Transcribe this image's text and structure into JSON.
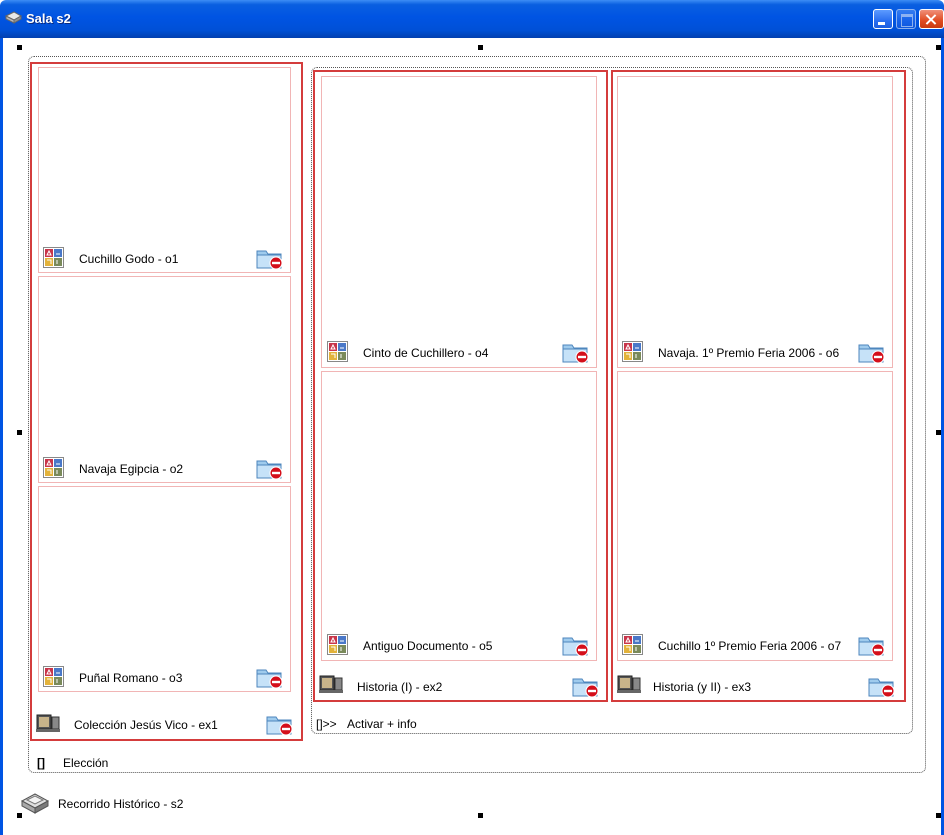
{
  "window": {
    "title": "Sala s2"
  },
  "sala": {
    "label": "Recorrido Histórico - s2"
  },
  "eleccion": {
    "label": "Elección",
    "marker": "[]"
  },
  "activar": {
    "label": "Activar + info",
    "marker": "[]>>"
  },
  "exhibits": {
    "ex1": {
      "label": "Colección Jesús Vico - ex1"
    },
    "ex2": {
      "label": "Historia (I) - ex2"
    },
    "ex3": {
      "label": "Historia (y II) - ex3"
    }
  },
  "objects": {
    "o1": {
      "label": "Cuchillo Godo - o1"
    },
    "o2": {
      "label": "Navaja Egipcia - o2"
    },
    "o3": {
      "label": "Puñal Romano - o3"
    },
    "o4": {
      "label": "Cinto de Cuchillero - o4"
    },
    "o5": {
      "label": "Antiguo Documento - o5"
    },
    "o6": {
      "label": "Navaja. 1º Premio Feria 2006 - o6"
    },
    "o7": {
      "label": "Cuchillo 1º Premio Feria 2006 - o7"
    }
  },
  "colors": {
    "titlebar": "#0054e3",
    "exhibit_border": "#d43c3c",
    "object_border": "#f1b5b5"
  },
  "icons": [
    "room-icon",
    "object-thumbnail-icon",
    "exhibit-icon",
    "folder-remove-icon",
    "minimize-icon",
    "maximize-icon",
    "close-icon"
  ]
}
